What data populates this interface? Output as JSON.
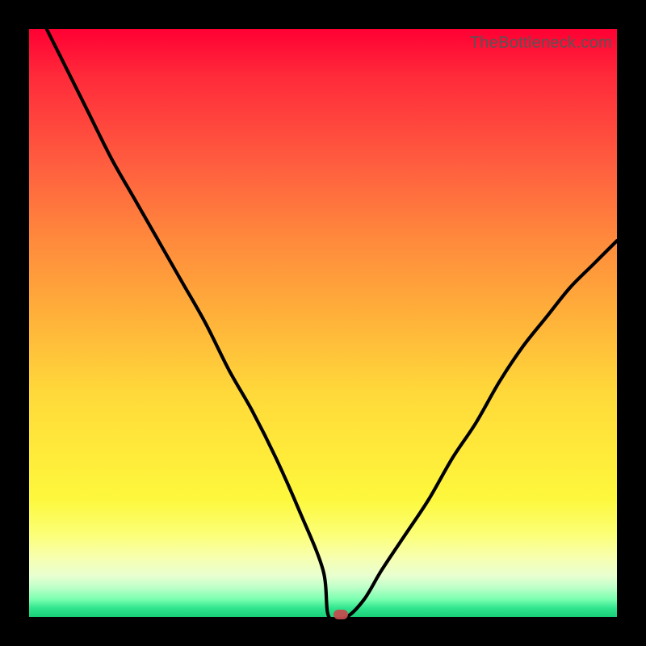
{
  "watermark": "TheBottleneck.com",
  "chart_data": {
    "type": "line",
    "title": "",
    "xlabel": "",
    "ylabel": "",
    "xlim": [
      0,
      100
    ],
    "ylim": [
      0,
      100
    ],
    "x": [
      3,
      6,
      10,
      14,
      18,
      22,
      26,
      30,
      34,
      38,
      42,
      46,
      50,
      51,
      54,
      57,
      60,
      64,
      68,
      72,
      76,
      80,
      84,
      88,
      92,
      96,
      100
    ],
    "values": [
      100,
      94,
      86,
      78,
      71,
      64,
      57,
      50,
      42,
      35,
      27,
      18,
      8,
      0,
      0,
      3,
      8,
      14,
      20,
      27,
      33,
      40,
      46,
      51,
      56,
      60,
      64
    ],
    "marker": {
      "x": 53,
      "y": 0
    },
    "gradient_stops": [
      {
        "pos": 0,
        "color": "#ff0033"
      },
      {
        "pos": 50,
        "color": "#ffb43a"
      },
      {
        "pos": 80,
        "color": "#fdf83d"
      },
      {
        "pos": 100,
        "color": "#18cf77"
      }
    ]
  }
}
